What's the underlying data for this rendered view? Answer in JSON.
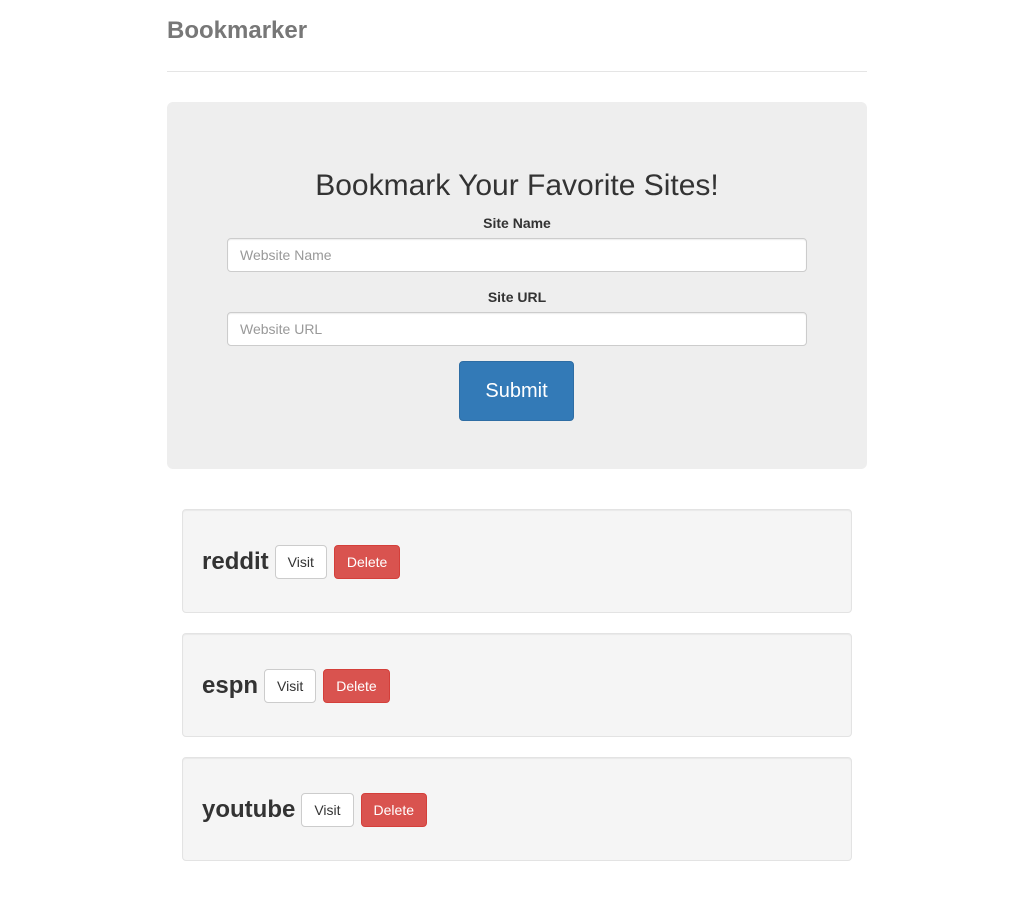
{
  "header": {
    "brand": "Bookmarker"
  },
  "form": {
    "title": "Bookmark Your Favorite Sites!",
    "site_name_label": "Site Name",
    "site_name_placeholder": "Website Name",
    "site_url_label": "Site URL",
    "site_url_placeholder": "Website URL",
    "submit_label": "Submit"
  },
  "bookmarks": [
    {
      "name": "reddit",
      "visit_label": "Visit",
      "delete_label": "Delete"
    },
    {
      "name": "espn",
      "visit_label": "Visit",
      "delete_label": "Delete"
    },
    {
      "name": "youtube",
      "visit_label": "Visit",
      "delete_label": "Delete"
    }
  ],
  "colors": {
    "primary": "#337ab7",
    "danger": "#d9534f",
    "jumbotron_bg": "#eeeeee",
    "well_bg": "#f5f5f5"
  }
}
